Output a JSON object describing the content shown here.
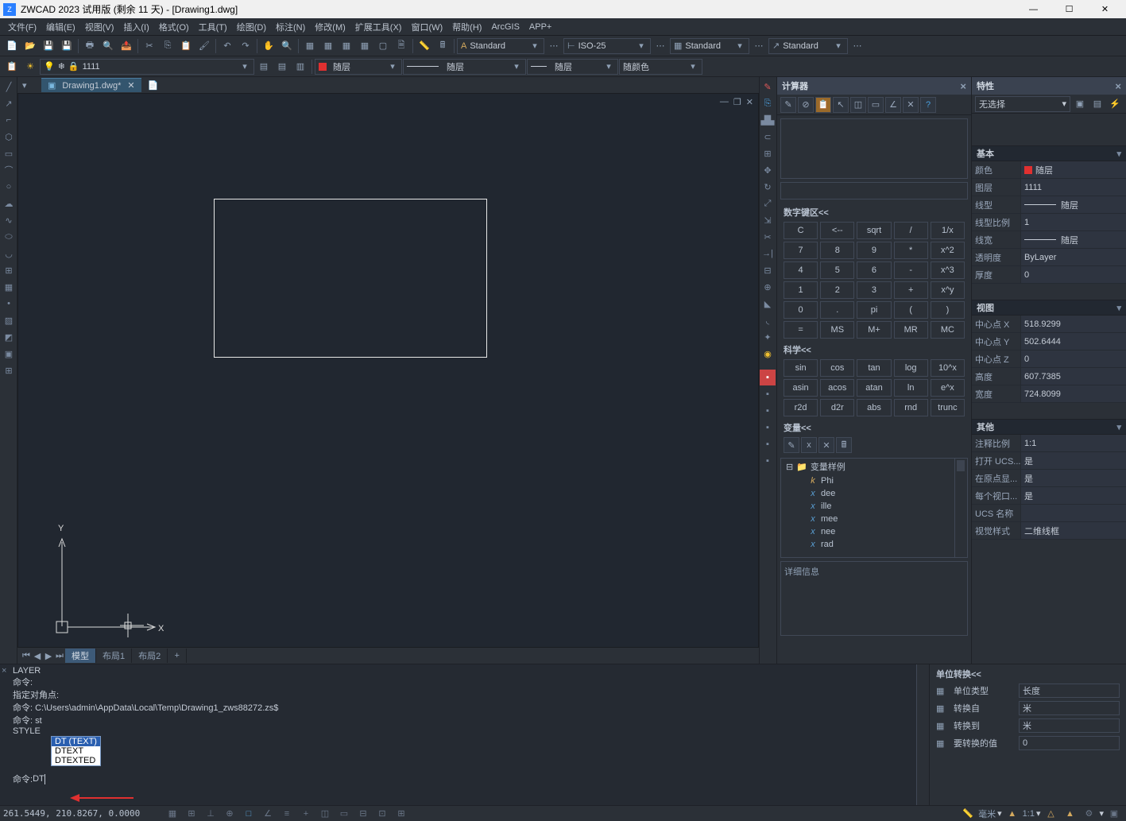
{
  "title": "ZWCAD 2023 试用版 (剩余 11 天) - [Drawing1.dwg]",
  "menu": [
    "文件(F)",
    "编辑(E)",
    "视图(V)",
    "插入(I)",
    "格式(O)",
    "工具(T)",
    "绘图(D)",
    "标注(N)",
    "修改(M)",
    "扩展工具(X)",
    "窗口(W)",
    "帮助(H)",
    "ArcGIS",
    "APP+"
  ],
  "layer_combo": "1111",
  "sty1": "Standard",
  "sty2": "ISO-25",
  "sty3": "Standard",
  "sty4": "Standard",
  "layer_props": {
    "p1": "随层",
    "p2": "随层",
    "p3": "随层",
    "p4": "随颜色"
  },
  "doctab": "Drawing1.dwg*",
  "tabs": {
    "t1": "模型",
    "t2": "布局1",
    "t3": "布局2",
    "plus": "+"
  },
  "calc": {
    "title": "计算器",
    "sect_num": "数字键区<<",
    "sect_sci": "科学<<",
    "sect_var": "变量<<",
    "sect_unit": "单位转换<<",
    "numkeys": [
      "C",
      "<--",
      "sqrt",
      "/",
      "1/x",
      "7",
      "8",
      "9",
      "*",
      "x^2",
      "4",
      "5",
      "6",
      "-",
      "x^3",
      "1",
      "2",
      "3",
      "+",
      "x^y",
      "0",
      ".",
      "pi",
      "(",
      ")",
      "=",
      "MS",
      "M+",
      "MR",
      "MC"
    ],
    "scikeys": [
      "sin",
      "cos",
      "tan",
      "log",
      "10^x",
      "asin",
      "acos",
      "atan",
      "ln",
      "e^x",
      "r2d",
      "d2r",
      "abs",
      "rnd",
      "trunc"
    ],
    "var_root": "变量样例",
    "vars": [
      "Phi",
      "dee",
      "ille",
      "mee",
      "nee",
      "rad"
    ],
    "detail": "详细信息",
    "u1": "单位类型",
    "u1v": "长度",
    "u2": "转换自",
    "u2v": "米",
    "u3": "转换到",
    "u3v": "米",
    "u4": "要转换的值",
    "u4v": "0"
  },
  "props": {
    "title": "特性",
    "sel": "无选择",
    "g1": "基本",
    "r1": "颜色",
    "r1v": "随层",
    "r2": "图层",
    "r2v": "1111",
    "r3": "线型",
    "r3v": "随层",
    "r4": "线型比例",
    "r4v": "1",
    "r5": "线宽",
    "r5v": "随层",
    "r6": "透明度",
    "r6v": "ByLayer",
    "r7": "厚度",
    "r7v": "0",
    "g2": "视图",
    "v1": "中心点 X",
    "v1v": "518.9299",
    "v2": "中心点 Y",
    "v2v": "502.6444",
    "v3": "中心点 Z",
    "v3v": "0",
    "v4": "高度",
    "v4v": "607.7385",
    "v5": "宽度",
    "v5v": "724.8099",
    "g3": "其他",
    "o1": "注释比例",
    "o1v": "1:1",
    "o2": "打开 UCS...",
    "o2v": "是",
    "o3": "在原点显...",
    "o3v": "是",
    "o4": "每个视口...",
    "o4v": "是",
    "o5": "UCS 名称",
    "o5v": "",
    "o6": "视觉样式",
    "o6v": "二维线框"
  },
  "cmd": {
    "h1": "LAYER",
    "h2": "命令:",
    "h3": "指定对角点:",
    "h4": "命令: C:\\Users\\admin\\AppData\\Local\\Temp\\Drawing1_zws88272.zs$",
    "h5": "命令: st",
    "h6": "STYLE",
    "prompt": "命令: ",
    "input": "DT",
    "ac1": "DT (TEXT)",
    "ac2": "DTEXT",
    "ac3": "DTEXTED"
  },
  "status": {
    "coord": "261.5449, 210.8267, 0.0000",
    "scale": "1:1",
    "mm": "毫米"
  }
}
